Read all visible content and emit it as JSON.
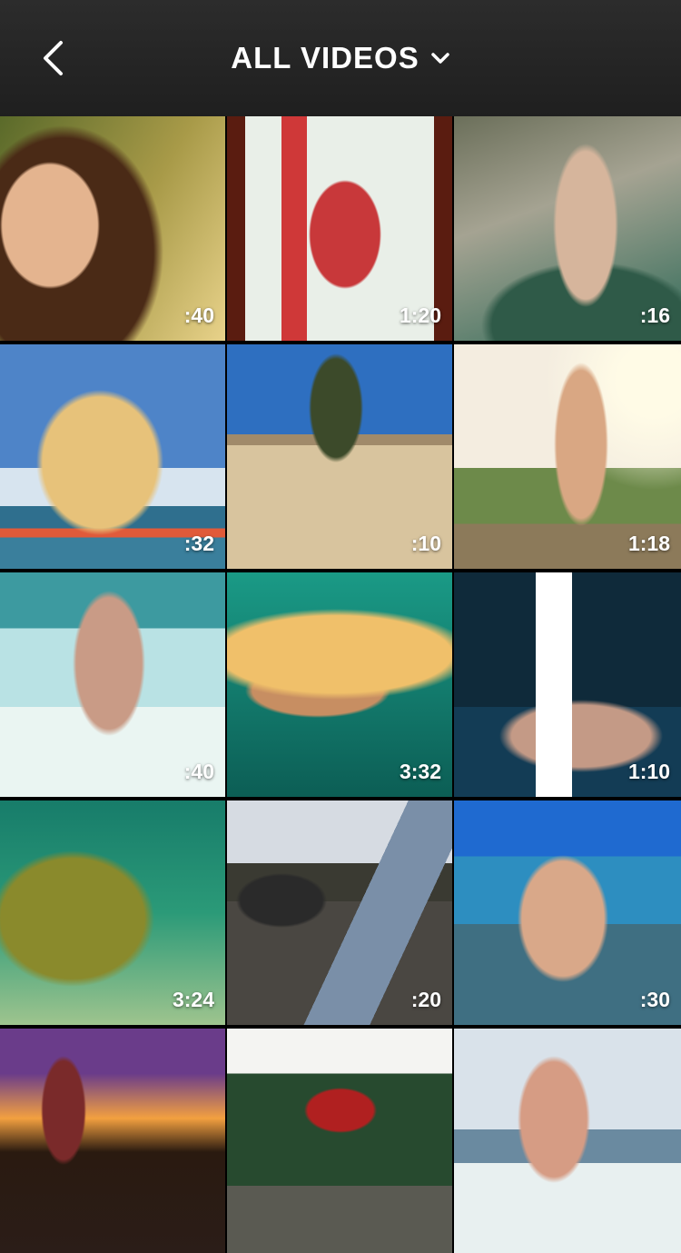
{
  "header": {
    "back_icon": "chevron-left-icon",
    "title": "ALL VIDEOS",
    "dropdown_icon": "chevron-down-icon"
  },
  "videos": [
    {
      "duration": ":40"
    },
    {
      "duration": "1:20"
    },
    {
      "duration": ":16"
    },
    {
      "duration": ":32"
    },
    {
      "duration": ":10"
    },
    {
      "duration": "1:18"
    },
    {
      "duration": ":40"
    },
    {
      "duration": "3:32"
    },
    {
      "duration": "1:10"
    },
    {
      "duration": "3:24"
    },
    {
      "duration": ":20"
    },
    {
      "duration": ":30"
    },
    {
      "duration": ""
    },
    {
      "duration": ""
    },
    {
      "duration": ""
    }
  ]
}
